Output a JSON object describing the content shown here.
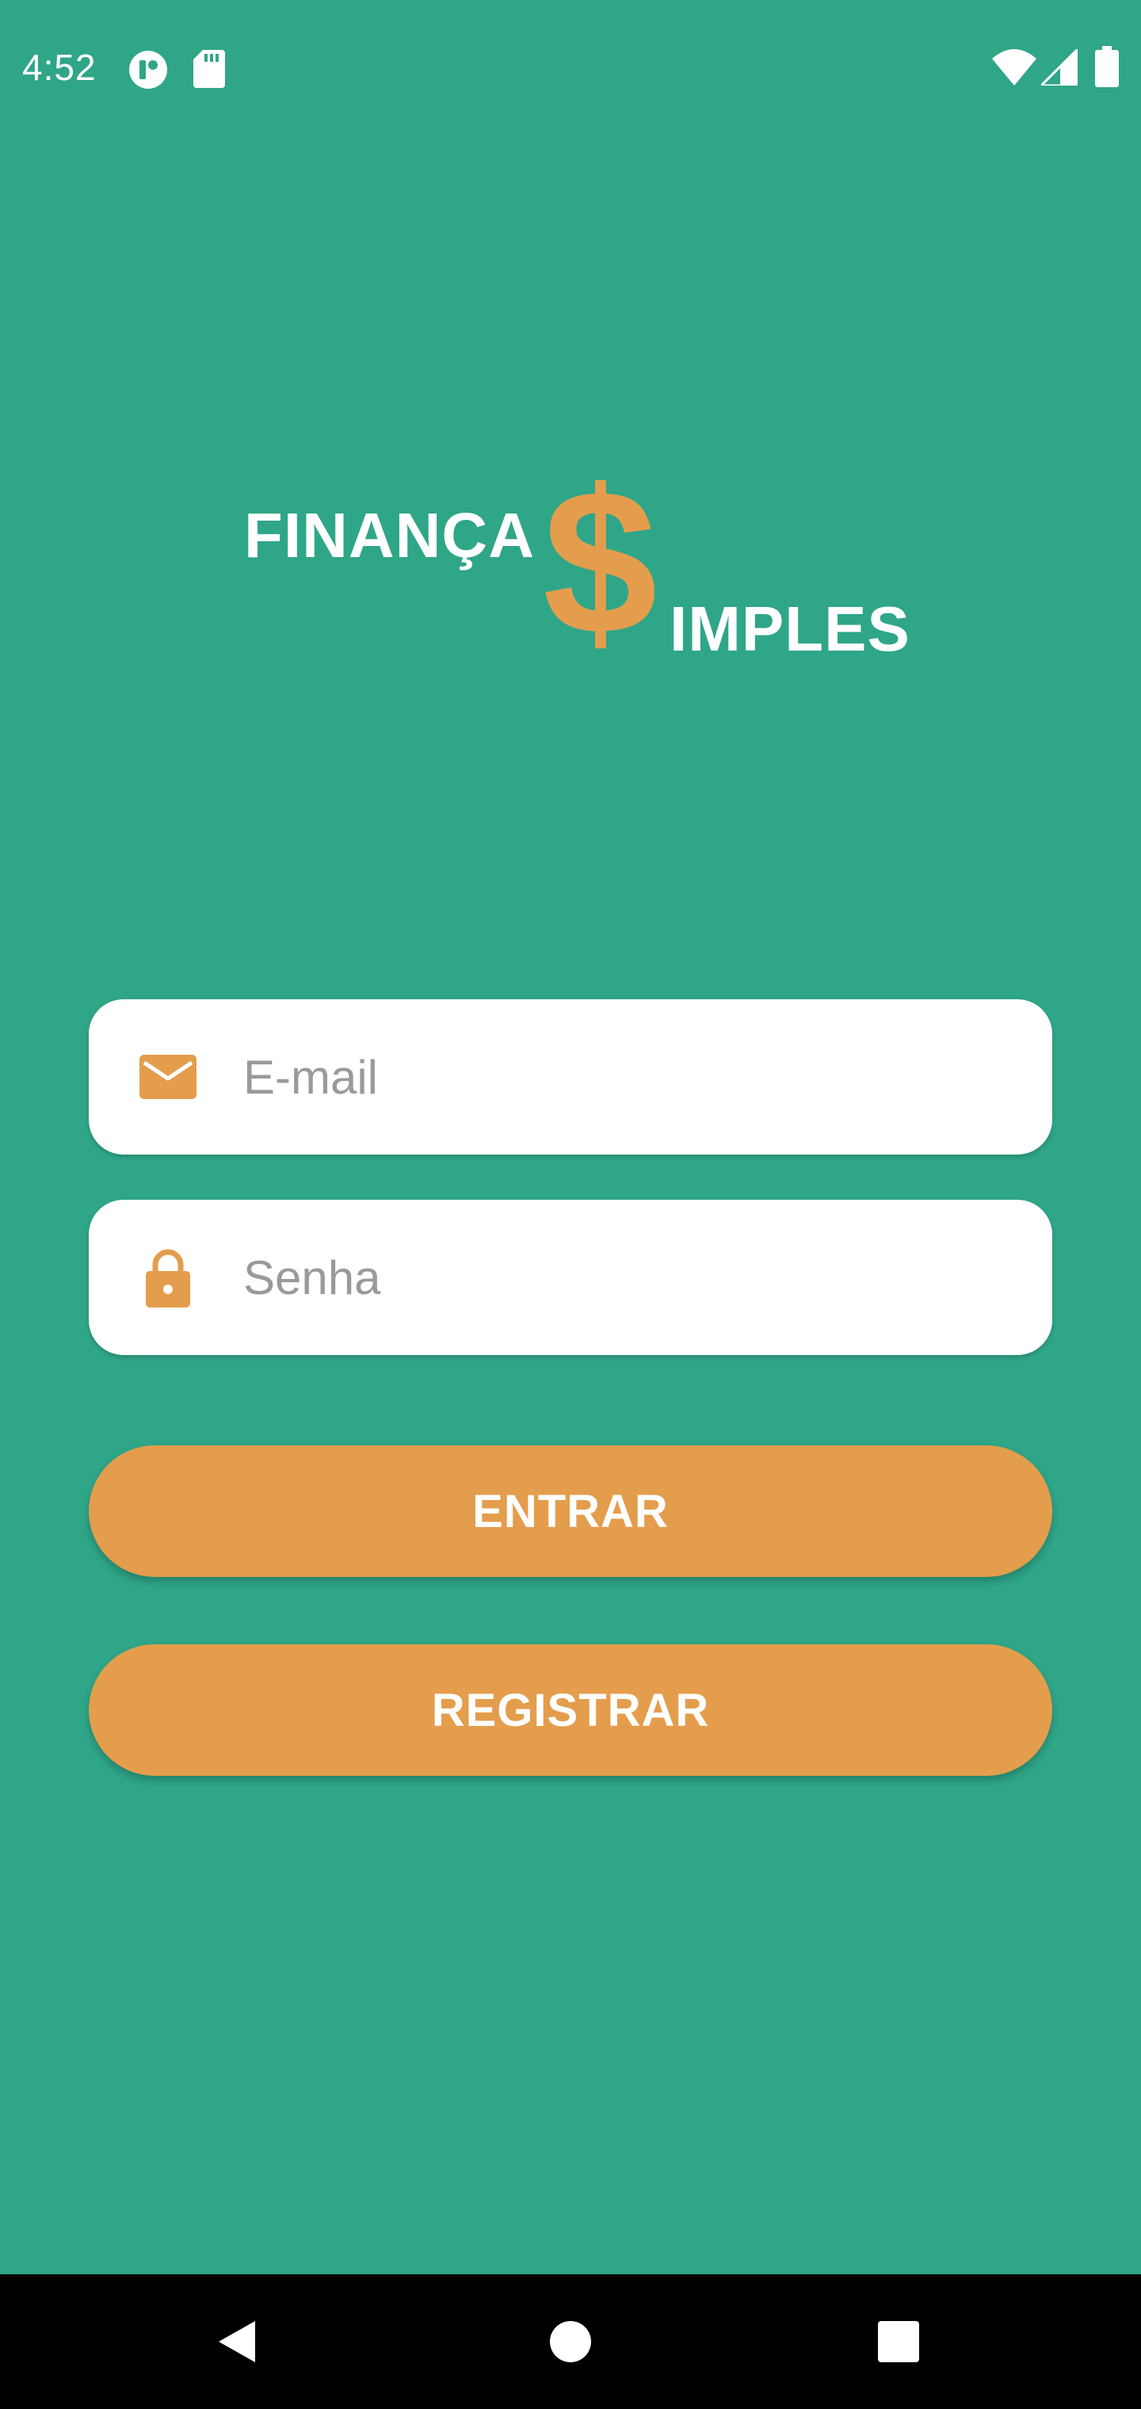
{
  "status_bar": {
    "time": "4:52",
    "left_icons": [
      "app-notification-icon",
      "sd-card-icon"
    ],
    "right_icons": [
      "wifi-icon",
      "cell-signal-icon",
      "battery-icon"
    ]
  },
  "logo": {
    "line1": "FINANÇA",
    "dollar": "$",
    "line2": "IMPLES",
    "colors": {
      "text": "#ffffff",
      "dollar": "#e49d4c"
    }
  },
  "form": {
    "email": {
      "placeholder": "E-mail",
      "value": "",
      "icon": "email-icon"
    },
    "password": {
      "placeholder": "Senha",
      "value": "",
      "icon": "lock-icon"
    }
  },
  "buttons": {
    "login_label": "ENTRAR",
    "register_label": "REGISTRAR"
  },
  "nav_bar": {
    "icons": [
      "back-icon",
      "home-icon",
      "recents-icon"
    ]
  },
  "colors": {
    "background": "#2fa688",
    "accent": "#e49d4c",
    "field_background": "#ffffff",
    "nav_background": "#000000"
  }
}
